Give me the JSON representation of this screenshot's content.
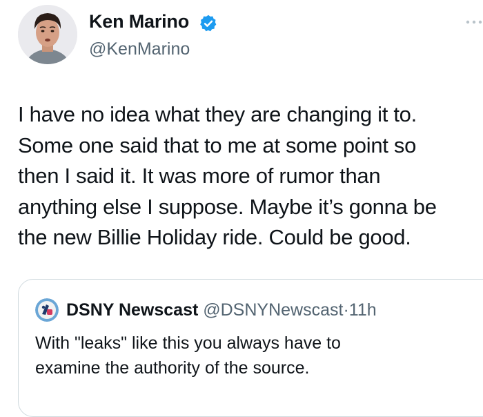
{
  "author": {
    "display_name": "Ken Marino",
    "handle": "@KenMarino",
    "verified": true,
    "verified_color": "#1d9bf0"
  },
  "icons": {
    "verified": "verified-badge-icon",
    "more": "more-options-icon"
  },
  "tweet": {
    "lines": [
      "I have no idea what they are changing it to.",
      "Some one said that to me at some point so",
      "then I said it. It was more of rumor than",
      "anything else I suppose. Maybe it’s gonna be",
      "the new Billie Holiday ride. Could be good."
    ]
  },
  "quoted_tweet": {
    "display_name": "DSNY Newscast",
    "handle": "@DSNYNewscast",
    "separator": "·",
    "time": "11h",
    "lines": [
      "With \"leaks\" like this you always have to",
      "examine the authority of the source."
    ]
  },
  "colors": {
    "text": "#0f1419",
    "secondary_text": "#536471",
    "border": "#cfd9de"
  }
}
